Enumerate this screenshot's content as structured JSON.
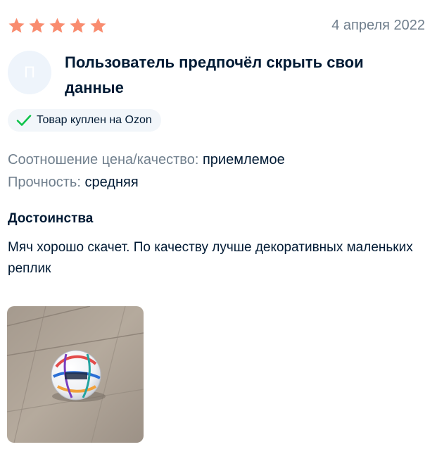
{
  "review": {
    "rating": 5,
    "date": "4 апреля 2022",
    "avatar_letter": "П",
    "author": "Пользователь предпочёл скрыть свои данные",
    "verified_badge": "Товар куплен на Ozon",
    "params": [
      {
        "label": "Соотношение цена/качество:",
        "value": "приемлемое"
      },
      {
        "label": "Прочность:",
        "value": "средняя"
      }
    ],
    "pros_title": "Достоинства",
    "pros_text": "Мяч хорошо скачет. По качеству лучше декоративных маленьких реплик"
  },
  "colors": {
    "star": "#f98c6f",
    "check": "#10c44c",
    "secondary_text": "#707f8d",
    "primary_text": "#001a34",
    "avatar_bg": "#eef4fb",
    "badge_bg": "#f2f6fa"
  },
  "icons": {
    "star": "star-icon",
    "check": "check-icon"
  }
}
